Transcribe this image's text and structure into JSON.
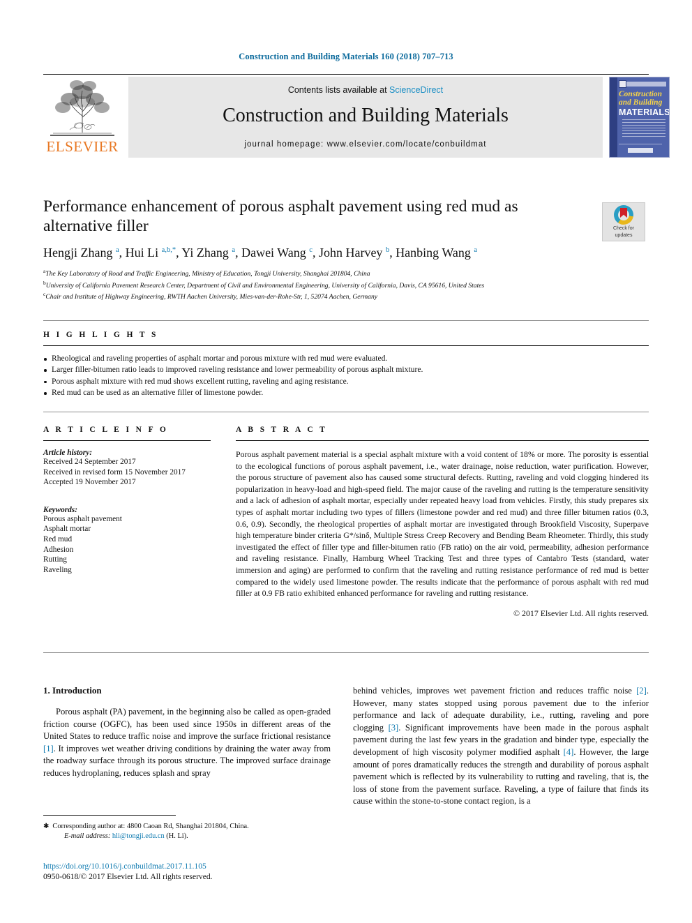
{
  "running_head": "Construction and Building Materials 160 (2018) 707–713",
  "masthead": {
    "publisher_name": "ELSEVIER",
    "contents_prefix": "Contents lists available at ",
    "contents_link": "ScienceDirect",
    "journal_title": "Construction and Building Materials",
    "homepage": "journal homepage: www.elsevier.com/locate/conbuildmat",
    "cover": {
      "line1": "Construction",
      "line2": "and Building",
      "line3": "MATERIALS"
    }
  },
  "article": {
    "title": "Performance enhancement of porous asphalt pavement using red mud as alternative filler",
    "crossmark_label_line1": "Check for",
    "crossmark_label_line2": "updates",
    "authors_html": "Hengji Zhang <sup>a</sup>, Hui Li <sup>a,b,</sup><sup>*</sup>, Yi Zhang <sup>a</sup>, Dawei Wang <sup>c</sup>, John Harvey <sup>b</sup>, Hanbing Wang <sup>a</sup>",
    "affiliations": [
      {
        "marker": "a",
        "text": "The Key Laboratory of Road and Traffic Engineering, Ministry of Education, Tongji University, Shanghai 201804, China"
      },
      {
        "marker": "b",
        "text": "University of California Pavement Research Center, Department of Civil and Environmental Engineering, University of California, Davis, CA 95616, United States"
      },
      {
        "marker": "c",
        "text": "Chair and Institute of Highway Engineering, RWTH Aachen University, Mies-van-der-Rohe-Str, 1, 52074 Aachen, Germany"
      }
    ]
  },
  "highlights": {
    "label": "H I G H L I G H T S",
    "items": [
      "Rheological and raveling properties of asphalt mortar and porous mixture with red mud were evaluated.",
      "Larger filler-bitumen ratio leads to improved raveling resistance and lower permeability of porous asphalt mixture.",
      "Porous asphalt mixture with red mud shows excellent rutting, raveling and aging resistance.",
      "Red mud can be used as an alternative filler of limestone powder."
    ]
  },
  "article_info": {
    "label": "A R T I C L E    I N F O",
    "history_heading": "Article history:",
    "history": [
      "Received 24 September 2017",
      "Received in revised form 15 November 2017",
      "Accepted 19 November 2017"
    ],
    "keywords_heading": "Keywords:",
    "keywords": [
      "Porous asphalt pavement",
      "Asphalt mortar",
      "Red mud",
      "Adhesion",
      "Rutting",
      "Raveling"
    ]
  },
  "abstract": {
    "label": "A B S T R A C T",
    "text": "Porous asphalt pavement material is a special asphalt mixture with a void content of 18% or more. The porosity is essential to the ecological functions of porous asphalt pavement, i.e., water drainage, noise reduction, water purification. However, the porous structure of pavement also has caused some structural defects. Rutting, raveling and void clogging hindered its popularization in heavy-load and high-speed field. The major cause of the raveling and rutting is the temperature sensitivity and a lack of adhesion of asphalt mortar, especially under repeated heavy load from vehicles. Firstly, this study prepares six types of asphalt mortar including two types of fillers (limestone powder and red mud) and three filler bitumen ratios (0.3, 0.6, 0.9). Secondly, the rheological properties of asphalt mortar are investigated through Brookfield Viscosity, Superpave high temperature binder criteria G*/sinδ, Multiple Stress Creep Recovery and Bending Beam Rheometer. Thirdly, this study investigated the effect of filler type and filler-bitumen ratio (FB ratio) on the air void, permeability, adhesion performance and raveling resistance. Finally, Hamburg Wheel Tracking Test and three types of Cantabro Tests (standard, water immersion and aging) are performed to confirm that the raveling and rutting resistance performance of red mud is better compared to the widely used limestone powder. The results indicate that the performance of porous asphalt with red mud filler at 0.9 FB ratio exhibited enhanced performance for raveling and rutting resistance.",
    "copyright": "© 2017 Elsevier Ltd. All rights reserved."
  },
  "body": {
    "section_heading": "1. Introduction",
    "left_paragraph_html": "Porous asphalt (PA) pavement, in the beginning also be called as open-graded friction course (OGFC), has been used since 1950s in different areas of the United States to reduce traffic noise and improve the surface frictional resistance <span class=\"ref\">[1]</span>. It improves wet weather driving conditions by draining the water away from the roadway surface through its porous structure. The improved surface drainage reduces hydroplaning, reduces splash and spray",
    "right_paragraph_html": "behind vehicles, improves wet pavement friction and reduces traffic noise <span class=\"ref\">[2]</span>. However, many states stopped using porous pavement due to the inferior performance and lack of adequate durability, i.e., rutting, raveling and pore clogging <span class=\"ref\">[3]</span>. Significant improvements have been made in the porous asphalt pavement during the last few years in the gradation and binder type, especially the development of high viscosity polymer modified asphalt <span class=\"ref\">[4]</span>. However, the large amount of pores dramatically reduces the strength and durability of porous asphalt pavement which is reflected by its vulnerability to rutting and raveling, that is, the loss of stone from the pavement surface. Raveling, a type of failure that finds its cause within the stone-to-stone contact region, is a"
  },
  "footnote": {
    "corresponding": "Corresponding author at: 4800 Caoan Rd, Shanghai 201804, China.",
    "email_label": "E-mail address:",
    "email": "hli@tongji.edu.cn",
    "email_owner": "(H. Li)."
  },
  "imprint": {
    "doi": "https://doi.org/10.1016/j.conbuildmat.2017.11.105",
    "issn_line": "0950-0618/© 2017 Elsevier Ltd. All rights reserved."
  },
  "colors": {
    "link": "#0f7ab0",
    "running_head": "#0b6a9c",
    "elsevier_orange": "#e87722",
    "cover_blue": "#4f63ab"
  }
}
